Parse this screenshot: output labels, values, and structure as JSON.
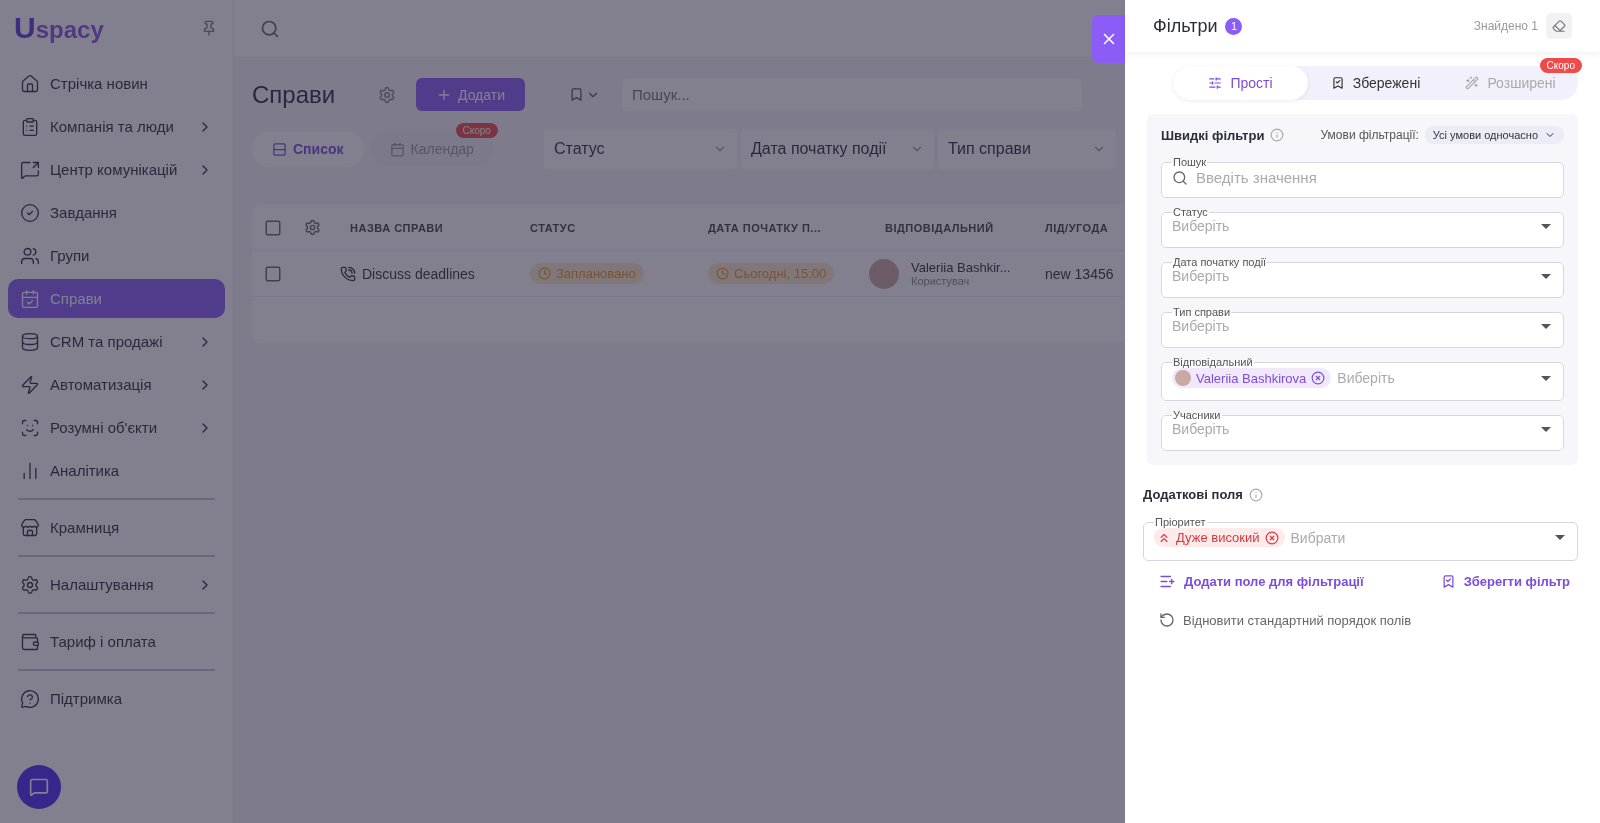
{
  "logo": {
    "mark": "U",
    "text": "spacy"
  },
  "sidebar": {
    "items": [
      {
        "label": "Стрічка новин",
        "selected": false,
        "has_submenu": false,
        "divider_after": false
      },
      {
        "label": "Компанія та люди",
        "selected": false,
        "has_submenu": true,
        "divider_after": false
      },
      {
        "label": "Центр комунікацій",
        "selected": false,
        "has_submenu": true,
        "divider_after": false
      },
      {
        "label": "Завдання",
        "selected": false,
        "has_submenu": false,
        "divider_after": false
      },
      {
        "label": "Групи",
        "selected": false,
        "has_submenu": false,
        "divider_after": false
      },
      {
        "label": "Справи",
        "selected": true,
        "has_submenu": false,
        "divider_after": false
      },
      {
        "label": "CRM та продажі",
        "selected": false,
        "has_submenu": true,
        "divider_after": false
      },
      {
        "label": "Автоматизація",
        "selected": false,
        "has_submenu": true,
        "divider_after": false
      },
      {
        "label": "Розумні об'єкти",
        "selected": false,
        "has_submenu": true,
        "divider_after": false
      },
      {
        "label": "Аналітика",
        "selected": false,
        "has_submenu": false,
        "divider_after": true
      },
      {
        "label": "Крамниця",
        "selected": false,
        "has_submenu": false,
        "divider_after": true
      },
      {
        "label": "Налаштування",
        "selected": false,
        "has_submenu": true,
        "divider_after": true
      },
      {
        "label": "Тариф і оплата",
        "selected": false,
        "has_submenu": false,
        "divider_after": true
      },
      {
        "label": "Підтримка",
        "selected": false,
        "has_submenu": false,
        "divider_after": false
      }
    ]
  },
  "page": {
    "title": "Справи",
    "add_button": "Додати",
    "search": {
      "placeholder": "Пошук..."
    },
    "views": [
      {
        "label": "Список",
        "selected": true,
        "disabled": false
      },
      {
        "label": "Календар",
        "selected": false,
        "disabled": true,
        "badge": "Скоро"
      }
    ],
    "filters": [
      "Статус",
      "Дата початку події",
      "Тип справи"
    ]
  },
  "table": {
    "columns": [
      "НАЗВА СПРАВИ",
      "СТАТУС",
      "ДАТА ПОЧАТКУ П...",
      "ВІДПОВІДАЛЬНИЙ",
      "ЛІД/УГОДА"
    ],
    "header_checked": false,
    "rows": [
      {
        "checked": false,
        "name": "Discuss deadlines",
        "status": "Заплановано",
        "date": "Сьогодні, 15:00",
        "person": "Valeriia Bashkir...",
        "role": "Користувач",
        "lead": "new 13456"
      }
    ]
  },
  "drawer": {
    "title": "Фільтри",
    "count": "1",
    "found": "Знайдено 1",
    "tabs": [
      {
        "label": "Прості",
        "selected": true,
        "disabled": false
      },
      {
        "label": "Збережені",
        "selected": false,
        "disabled": false
      },
      {
        "label": "Розширені",
        "selected": false,
        "disabled": true,
        "badge": "Скоро"
      }
    ],
    "quick": {
      "title": "Швидкі фільтри",
      "condition_label": "Умови фільтрації:",
      "condition_value": "Усі умови одночасно",
      "fields": [
        {
          "kind": "search",
          "label": "Пошук",
          "placeholder": "Введіть значення"
        },
        {
          "kind": "select",
          "label": "Статус",
          "placeholder": "Виберіть"
        },
        {
          "kind": "select",
          "label": "Дата початку події",
          "placeholder": "Виберіть"
        },
        {
          "kind": "select",
          "label": "Тип справи",
          "placeholder": "Виберіть"
        },
        {
          "kind": "select",
          "label": "Відповідальний",
          "placeholder": "Виберіть",
          "chips": [
            {
              "kind": "person",
              "label": "Valeriia Bashkirova"
            }
          ]
        },
        {
          "kind": "select",
          "label": "Учасники",
          "placeholder": "Виберіть"
        }
      ]
    },
    "extra": {
      "title": "Додаткові поля",
      "fields": [
        {
          "kind": "select",
          "label": "Пріоритет",
          "placeholder": "Вибрати",
          "chips": [
            {
              "kind": "priority",
              "label": "Дуже високий"
            }
          ]
        }
      ]
    },
    "add_field": "Додати поле для фільтрації",
    "save_filter": "Зберегти фільтр",
    "reset_order": "Відновити стандартний порядок полів"
  }
}
